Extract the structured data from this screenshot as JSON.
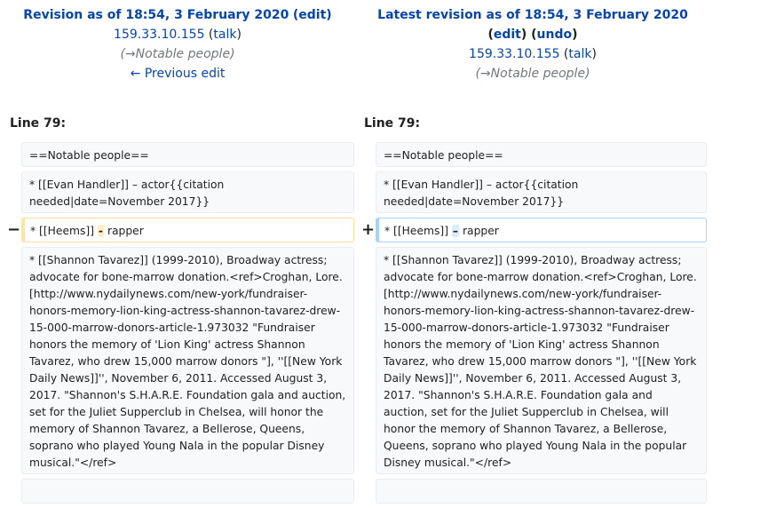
{
  "left": {
    "title_prefix": "Revision as of 18:54, 3 February 2020",
    "open_paren": "(",
    "edit": "edit",
    "close_paren": ")",
    "user": "159.33.10.155",
    "talk": "talk",
    "comment": "(→Notable people)",
    "prev_edit": "← Previous edit",
    "line_label": "Line 79:",
    "lines": {
      "l1": "==Notable people==",
      "l2": "* [[Evan Handler]] – actor{{citation needed|date=November 2017}}",
      "l3_a": "* [[Heems]] ",
      "l3_hl": "-",
      "l3_b": " rapper",
      "l4": "* [[Shannon Tavarez]] (1999-2010), Broadway actress; advocate for bone-marrow donation.<ref>Croghan, Lore. [http://www.nydailynews.com/new-york/fundraiser-honors-memory-lion-king-actress-shannon-tavarez-drew-15-000-marrow-donors-article-1.973032 \"Fundraiser honors the memory of 'Lion King' actress Shannon Tavarez, who drew 15,000 marrow donors \"], ''[[New York Daily News]]'', November 6, 2011. Accessed August 3, 2017. \"Shannon's S.H.A.R.E. Foundation gala and auction, set for the Juliet Supperclub in Chelsea, will honor the memory of Shannon Tavarez, a Bellerose, Queens, soprano who played Young Nala in the popular Disney musical.\"</ref>"
    },
    "marker": "−"
  },
  "right": {
    "title": "Latest revision as of 18:54, 3 February 2020",
    "edit": "edit",
    "undo": "undo",
    "user": "159.33.10.155",
    "talk": "talk",
    "comment": "(→Notable people)",
    "line_label": "Line 79:",
    "lines": {
      "l1": "==Notable people==",
      "l2": "* [[Evan Handler]] – actor{{citation needed|date=November 2017}}",
      "l3_a": "* [[Heems]] ",
      "l3_hl": "–",
      "l3_b": " rapper",
      "l4": "* [[Shannon Tavarez]] (1999-2010), Broadway actress; advocate for bone-marrow donation.<ref>Croghan, Lore. [http://www.nydailynews.com/new-york/fundraiser-honors-memory-lion-king-actress-shannon-tavarez-drew-15-000-marrow-donors-article-1.973032 \"Fundraiser honors the memory of 'Lion King' actress Shannon Tavarez, who drew 15,000 marrow donors \"], ''[[New York Daily News]]'', November 6, 2011. Accessed August 3, 2017. \"Shannon's S.H.A.R.E. Foundation gala and auction, set for the Juliet Supperclub in Chelsea, will honor the memory of Shannon Tavarez, a Bellerose, Queens, soprano who played Young Nala in the popular Disney musical.\"</ref>"
    },
    "marker": "+"
  }
}
